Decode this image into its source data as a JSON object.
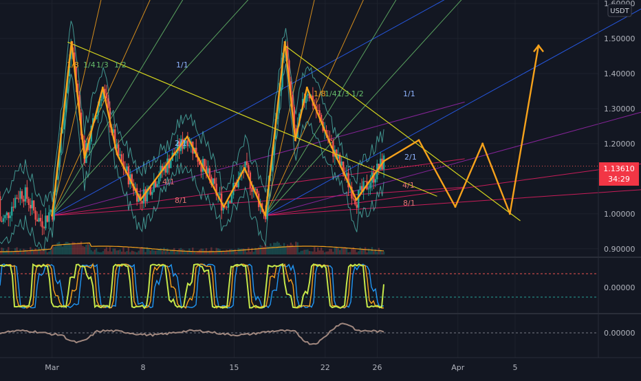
{
  "currency_badge": "USDT",
  "price_tag": {
    "value": "1.13610",
    "countdown": "34:29",
    "color": "#f23645"
  },
  "colors": {
    "background": "#131722",
    "grid": "#1e222d",
    "zigzag": "#f7a21b",
    "trendline": "#d4d41e",
    "candle_up": "#26a69a",
    "candle_down": "#ef5350",
    "band": "#4db6ac",
    "gann_blue": "#2962ff",
    "gann_purple": "#9c27b0",
    "gann_pink": "#e91e63",
    "gann_yellow": "#f7a21b",
    "gann_green": "#66bb6a"
  },
  "chart_data": [
    {
      "type": "line",
      "panel": "price",
      "x_ticks": [
        "Mar",
        "8",
        "15",
        "22",
        "26",
        "Apr",
        "5"
      ],
      "y_ticks": [
        "1.60000",
        "1.50000",
        "1.40000",
        "1.30000",
        "1.20000",
        "1.10000",
        "1.00000",
        "0.90000"
      ],
      "ylim": [
        0.88,
        1.61
      ],
      "x_day_range": [
        -4,
        42
      ],
      "current_price": 1.1361,
      "gann_labels": [
        "1/8",
        "1/4",
        "1/3",
        "1/2",
        "1/1",
        "2/1",
        "4/1",
        "8/1"
      ],
      "zigzag_projection": [
        {
          "x": 0,
          "y": 0.995
        },
        {
          "x": 1.5,
          "y": 1.49
        },
        {
          "x": 2.5,
          "y": 1.16
        },
        {
          "x": 3.9,
          "y": 1.36
        },
        {
          "x": 5.0,
          "y": 1.17
        },
        {
          "x": 6.8,
          "y": 1.04
        },
        {
          "x": 10.4,
          "y": 1.22
        },
        {
          "x": 13.2,
          "y": 1.02
        },
        {
          "x": 14.8,
          "y": 1.13
        },
        {
          "x": 16.4,
          "y": 0.995
        },
        {
          "x": 17.9,
          "y": 1.49
        },
        {
          "x": 18.7,
          "y": 1.21
        },
        {
          "x": 19.6,
          "y": 1.36
        },
        {
          "x": 21.5,
          "y": 1.19
        },
        {
          "x": 23.4,
          "y": 1.04
        },
        {
          "x": 25.5,
          "y": 1.15
        },
        {
          "x": 28.2,
          "y": 1.21
        },
        {
          "x": 31.0,
          "y": 1.02
        },
        {
          "x": 33.1,
          "y": 1.2
        },
        {
          "x": 35.2,
          "y": 1.0
        },
        {
          "x": 37.4,
          "y": 1.48
        }
      ],
      "trendlines": [
        {
          "x1": 1.2,
          "y1": 1.49,
          "x2": 29.6,
          "y2": 1.05
        },
        {
          "x1": 17.9,
          "y1": 1.48,
          "x2": 36.0,
          "y2": 0.98
        }
      ]
    },
    {
      "type": "line",
      "panel": "oscillator",
      "y_ticks": [
        "0.00000"
      ],
      "series": [
        {},
        {},
        {}
      ]
    },
    {
      "type": "line",
      "panel": "momentum",
      "y_ticks": [
        "0.00000"
      ],
      "series": [
        {}
      ]
    }
  ]
}
